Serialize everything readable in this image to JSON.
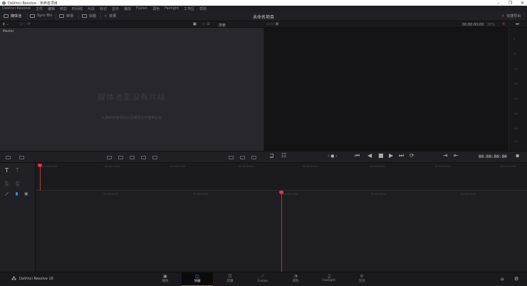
{
  "window": {
    "title": "DaVinci Resolve - 未命名项目",
    "controls": [
      "–",
      "❐",
      "✕"
    ]
  },
  "menu": [
    "DaVinci Resolve",
    "文件",
    "编辑",
    "修剪",
    "时间线",
    "片段",
    "标记",
    "显示",
    "播放",
    "Fusion",
    "调色",
    "Fairlight",
    "工作区",
    "帮助"
  ],
  "toolbar": {
    "media_pool": "媒体池",
    "sync_bin": "Sync Bin",
    "transitions": "转场",
    "titles": "标题",
    "effects": "效果",
    "project_title": "未命名项目",
    "quick_export": "快捷导出"
  },
  "subbar": {
    "search_placeholder": "搜索",
    "timecode": "00:00:00:00",
    "zoom": "26%"
  },
  "media_pool": {
    "bin": "Master",
    "empty_title": "媒体池里没有片段",
    "empty_hint": "从媒体存储添加片段或将文件拖到此处"
  },
  "meter_ticks": [
    "0",
    "-5",
    "-10",
    "-15",
    "-20",
    "-30",
    "-40",
    "-50"
  ],
  "transport": {
    "timecode": "00:00:00:00"
  },
  "timeline": {
    "upper_ruler": [
      "00:00:00:00",
      "00:00:10:00",
      "00:00:20:00",
      "00:00:30:00",
      "00:00:40:00",
      "00:00:50:00",
      "00:01:00:00",
      "00:01:10:00"
    ],
    "lower_ruler": [
      "00:00:04:00",
      "00:00:08:00",
      "00:00:12:00",
      "00:00:16:00",
      "00:00:20:00"
    ]
  },
  "bottom": {
    "brand": "DaVinci Resolve 16",
    "pages": [
      {
        "label": "媒体",
        "icon": "▣"
      },
      {
        "label": "快编",
        "icon": "◫"
      },
      {
        "label": "剪辑",
        "icon": "☷"
      },
      {
        "label": "Fusion",
        "icon": "⟋"
      },
      {
        "label": "调色",
        "icon": "◔"
      },
      {
        "label": "Fairlight",
        "icon": "♫"
      },
      {
        "label": "交付",
        "icon": "⚲"
      }
    ],
    "active": "快编"
  },
  "colors": {
    "accent": "#e33333",
    "active_icon": "#6a7dff"
  }
}
